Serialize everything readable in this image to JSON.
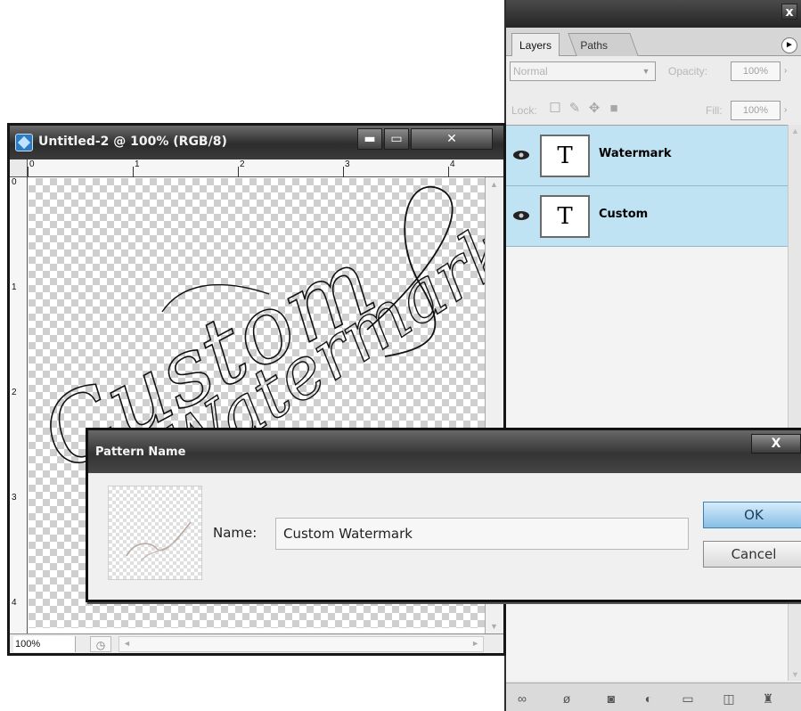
{
  "layers_panel": {
    "tabs": [
      "Layers",
      "Paths"
    ],
    "close_glyph": "x",
    "menu_glyph": "►",
    "blend_mode": "Normal",
    "opacity_label": "Opacity:",
    "opacity_value": "100%",
    "lock_label": "Lock:",
    "fill_label": "Fill:",
    "fill_value": "100%",
    "layers": [
      {
        "name": "Watermark",
        "thumb": "T",
        "type_icon": "text-layer-icon"
      },
      {
        "name": "Custom",
        "thumb": "T",
        "type_icon": "text-layer-icon"
      }
    ],
    "bottom_icons": [
      "link-icon",
      "fx-icon",
      "mask-icon",
      "adjustment-icon",
      "folder-icon",
      "new-layer-icon",
      "trash-icon"
    ]
  },
  "document": {
    "title": "Untitled-2 @ 100% (RGB/8)",
    "ruler_top": [
      "0",
      "1",
      "2",
      "3",
      "4"
    ],
    "ruler_left": [
      "0",
      "1",
      "2",
      "3",
      "4"
    ],
    "canvas_text_line1": "Custom",
    "canvas_text_line2": "Watermark",
    "zoom": "100%",
    "buttons": {
      "minimize": "▬",
      "maximize": "▭",
      "close": "✕"
    }
  },
  "dialog": {
    "title": "Pattern Name",
    "close_glyph": "X",
    "name_label": "Name:",
    "name_value": "Custom Watermark",
    "ok_label": "OK",
    "cancel_label": "Cancel"
  },
  "colors": {
    "layer_selected": "#bfe3f3",
    "titlebar_dark": "#2c2c2c",
    "ok_button": "#86bfe6"
  }
}
